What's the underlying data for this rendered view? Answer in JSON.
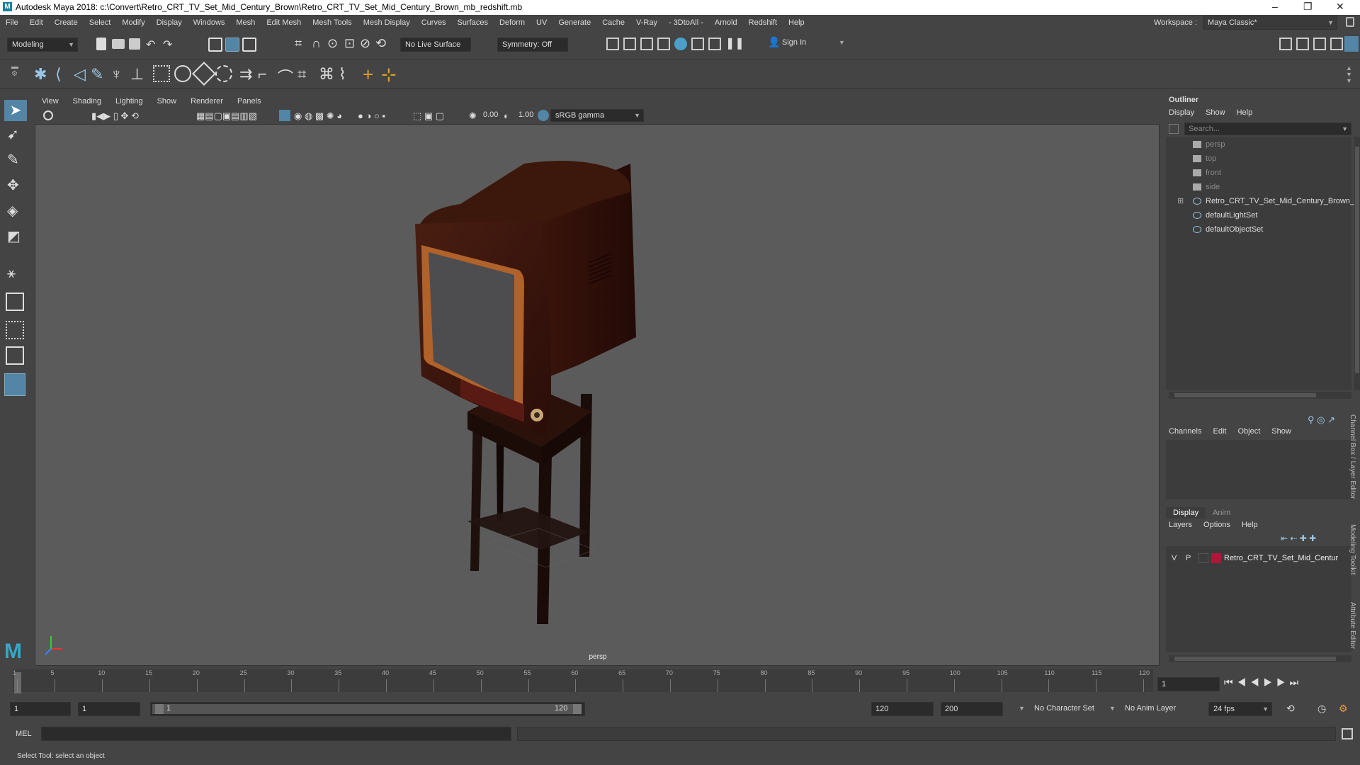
{
  "window": {
    "title": "Autodesk Maya 2018: c:\\Convert\\Retro_CRT_TV_Set_Mid_Century_Brown\\Retro_CRT_TV_Set_Mid_Century_Brown_mb_redshift.mb",
    "workspace_label": "Workspace :",
    "workspace_value": "Maya Classic*"
  },
  "menus": [
    "File",
    "Edit",
    "Create",
    "Select",
    "Modify",
    "Display",
    "Windows",
    "Mesh",
    "Edit Mesh",
    "Mesh Tools",
    "Mesh Display",
    "Curves",
    "Surfaces",
    "Deform",
    "UV",
    "Generate",
    "Cache",
    "V-Ray",
    "- 3DtoAll -",
    "Arnold",
    "Redshift",
    "Help"
  ],
  "statusline": {
    "mode": "Modeling",
    "live_surface": "No Live Surface",
    "symmetry": "Symmetry: Off",
    "sign_in": "Sign In"
  },
  "viewport": {
    "menus": [
      "View",
      "Shading",
      "Lighting",
      "Show",
      "Renderer",
      "Panels"
    ],
    "exposure": "0.00",
    "gamma": "1.00",
    "color_space": "sRGB gamma",
    "camera_label": "persp"
  },
  "outliner": {
    "title": "Outliner",
    "menus": [
      "Display",
      "Show",
      "Help"
    ],
    "search_placeholder": "Search...",
    "items": [
      {
        "label": "persp",
        "icon": "camera-icon",
        "dim": true
      },
      {
        "label": "top",
        "icon": "camera-icon",
        "dim": true
      },
      {
        "label": "front",
        "icon": "camera-icon",
        "dim": true
      },
      {
        "label": "side",
        "icon": "camera-icon",
        "dim": true
      },
      {
        "label": "Retro_CRT_TV_Set_Mid_Century_Brown_",
        "icon": "transform-icon",
        "dim": false
      },
      {
        "label": "defaultLightSet",
        "icon": "set-icon",
        "dim": false
      },
      {
        "label": "defaultObjectSet",
        "icon": "set-icon",
        "dim": false
      }
    ]
  },
  "channelbox": {
    "menus": [
      "Channels",
      "Edit",
      "Object",
      "Show"
    ]
  },
  "layers": {
    "tabs": [
      "Display",
      "Anim"
    ],
    "menus": [
      "Layers",
      "Options",
      "Help"
    ],
    "row": {
      "v": "V",
      "p": "P",
      "name": "Retro_CRT_TV_Set_Mid_Centur",
      "color": "#b0163a"
    }
  },
  "side_tabs": [
    "Channel Box / Layer Editor",
    "Modeling Toolkit",
    "Attribute Editor"
  ],
  "timeline": {
    "ticks": [
      "1",
      "5",
      "10",
      "15",
      "20",
      "25",
      "30",
      "35",
      "40",
      "45",
      "50",
      "55",
      "60",
      "65",
      "70",
      "75",
      "80",
      "85",
      "90",
      "95",
      "100",
      "105",
      "110",
      "115",
      "120"
    ],
    "current_frame": "1"
  },
  "range": {
    "start": "1",
    "playback_start": "1",
    "slider_start": "1",
    "slider_end": "120",
    "playback_end": "120",
    "end": "200",
    "character_set": "No Character Set",
    "anim_layer": "No Anim Layer",
    "fps": "24 fps"
  },
  "cmdline": {
    "label": "MEL"
  },
  "helpline": {
    "text": "Select Tool: select an object"
  },
  "colors": {
    "bg": "#444444",
    "viewport": "#5b5b5b",
    "accent": "#5285a6",
    "layer_color": "#b0163a"
  }
}
